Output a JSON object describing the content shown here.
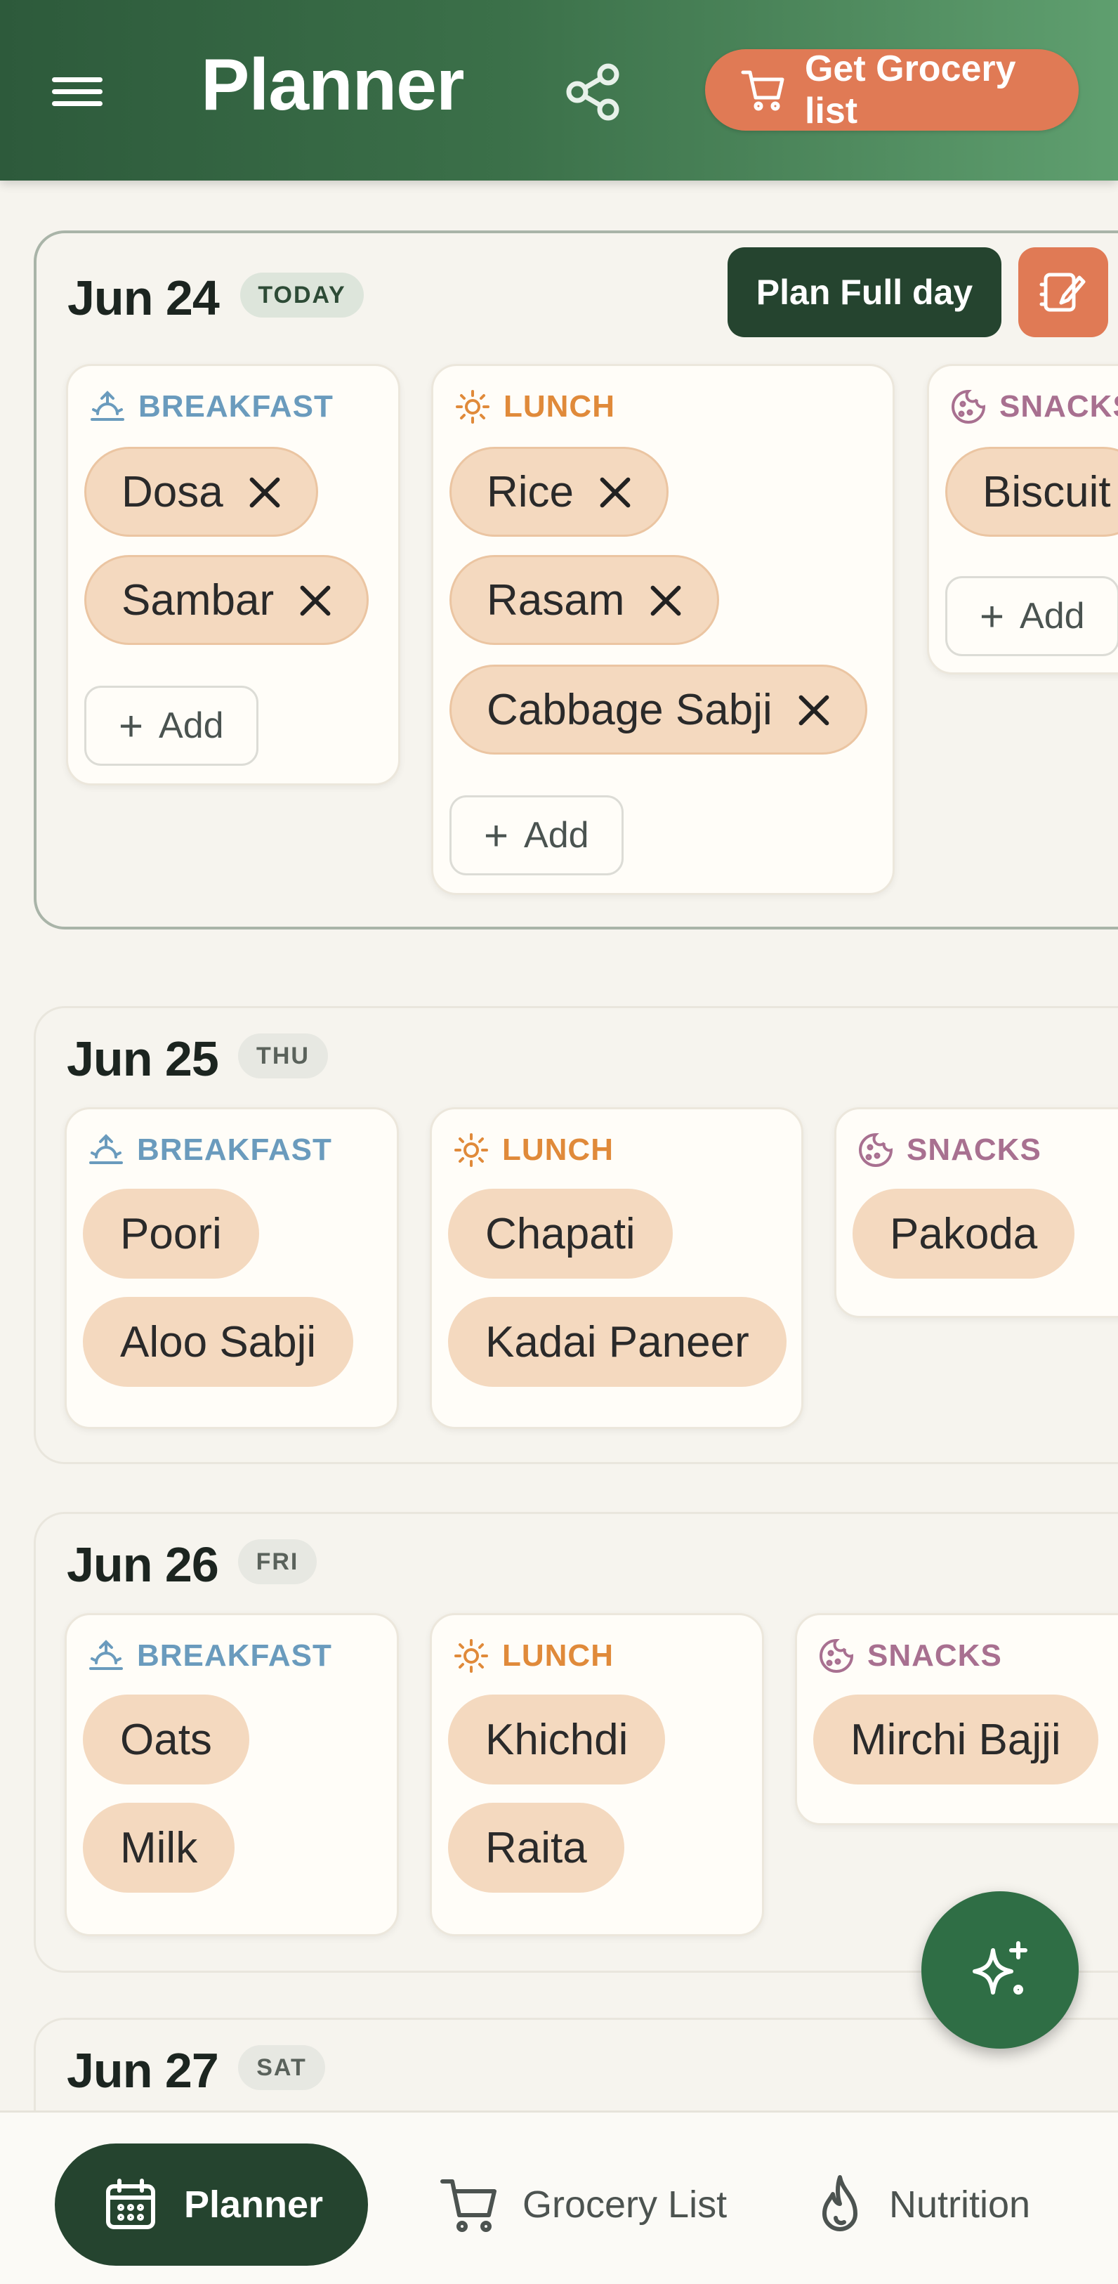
{
  "header": {
    "title": "Planner",
    "grocery_button_label": "Get Grocery list"
  },
  "days": [
    {
      "date": "Jun 24",
      "badge": "TODAY",
      "plan_button_label": "Plan Full day",
      "meals": [
        {
          "type": "BREAKFAST",
          "items": [
            "Dosa",
            "Sambar"
          ],
          "add_label": "Add"
        },
        {
          "type": "LUNCH",
          "items": [
            "Rice",
            "Rasam",
            "Cabbage Sabji"
          ],
          "add_label": "Add"
        },
        {
          "type": "SNACKS",
          "items": [
            "Biscuit"
          ],
          "add_label": "Add"
        }
      ]
    },
    {
      "date": "Jun 25",
      "badge": "THU",
      "meals": [
        {
          "type": "BREAKFAST",
          "items": [
            "Poori",
            "Aloo Sabji"
          ]
        },
        {
          "type": "LUNCH",
          "items": [
            "Chapati",
            "Kadai Paneer"
          ]
        },
        {
          "type": "SNACKS",
          "items": [
            "Pakoda"
          ]
        }
      ]
    },
    {
      "date": "Jun 26",
      "badge": "FRI",
      "meals": [
        {
          "type": "BREAKFAST",
          "items": [
            "Oats",
            "Milk"
          ]
        },
        {
          "type": "LUNCH",
          "items": [
            "Khichdi",
            "Raita"
          ]
        },
        {
          "type": "SNACKS",
          "items": [
            "Mirchi Bajji"
          ]
        }
      ]
    },
    {
      "date": "Jun 27",
      "badge": "SAT",
      "meals": []
    }
  ],
  "bottom_nav": {
    "planner": "Planner",
    "grocery": "Grocery List",
    "nutrition": "Nutrition"
  },
  "colors": {
    "primary_dark": "#25442f",
    "accent_orange": "#e07a55",
    "chip_bg": "#f4d9bf",
    "breakfast": "#6a9bbd",
    "lunch": "#e08a3a",
    "snacks": "#a87090"
  },
  "icons": {
    "menu": "menu-icon",
    "share": "share-icon",
    "cart": "cart-icon",
    "note": "note-edit-icon",
    "breakfast": "sunrise-icon",
    "lunch": "sun-icon",
    "snacks": "cookie-icon",
    "fab": "sparkle-icon",
    "calendar": "calendar-icon",
    "nutrition": "flame-icon"
  }
}
